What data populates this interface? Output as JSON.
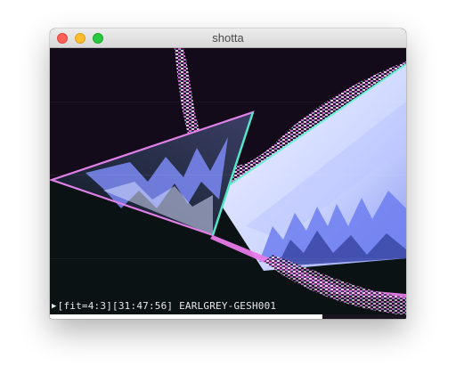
{
  "window": {
    "title": "shotta"
  },
  "player": {
    "play_glyph": "▶",
    "osd_text": "[fit=4:3][31:47:56] EARLGREY-GESH001",
    "progress": 0.765
  },
  "colors": {
    "frame_bg": "#120a1a",
    "accent_cyan": "#3de0c0",
    "accent_magenta": "#e070e0",
    "blade_blue": "#6d7ef0",
    "blade_light": "#dfe4ff"
  },
  "icons": {
    "close": "close-traffic-light-icon",
    "minimize": "minimize-traffic-light-icon",
    "maximize": "zoom-traffic-light-icon",
    "play": "play-icon"
  }
}
